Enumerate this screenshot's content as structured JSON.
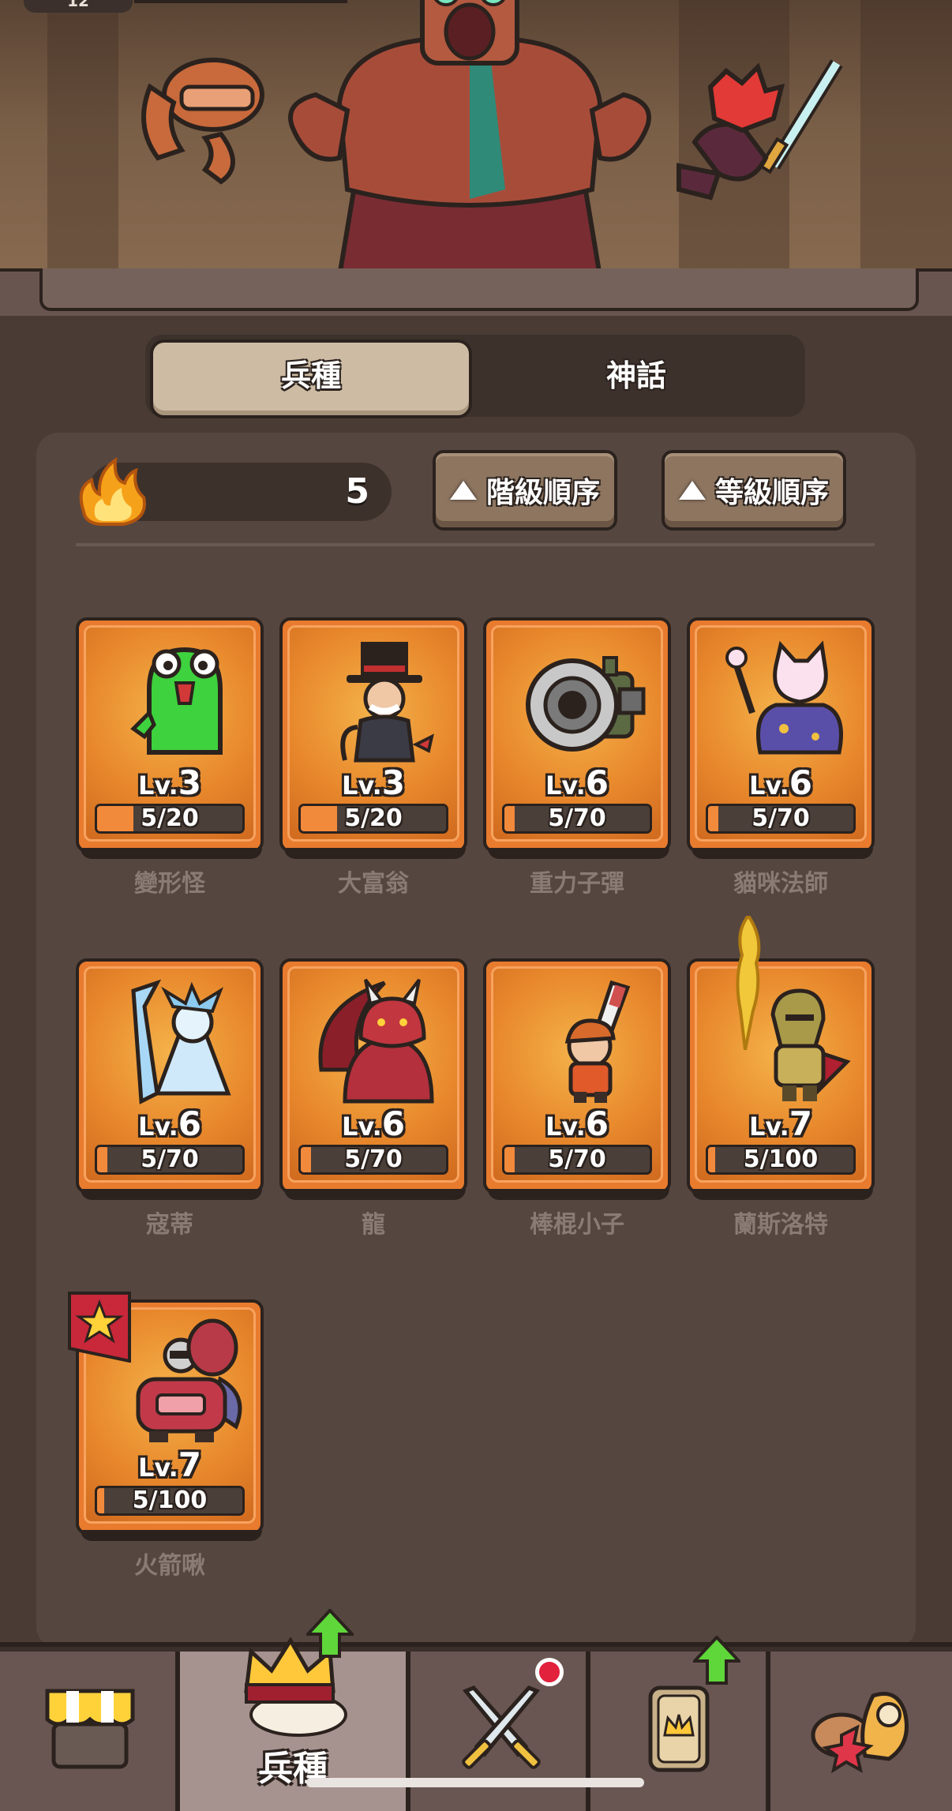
{
  "banner": {
    "level_pill": "12"
  },
  "tabs": [
    {
      "label": "兵種",
      "active": true
    },
    {
      "label": "神話",
      "active": false
    }
  ],
  "resource": {
    "icon": "fire-icon",
    "count": "5"
  },
  "sort_buttons": [
    {
      "label": "階級順序",
      "icon": "up-triangle-icon"
    },
    {
      "label": "等級順序",
      "icon": "up-triangle-icon"
    }
  ],
  "units": [
    {
      "name": "變形怪",
      "level_prefix": "Lv.",
      "level": "3",
      "progress_text": "5/20",
      "progress": 0.25
    },
    {
      "name": "大富翁",
      "level_prefix": "Lv.",
      "level": "3",
      "progress_text": "5/20",
      "progress": 0.25
    },
    {
      "name": "重力子彈",
      "level_prefix": "Lv.",
      "level": "6",
      "progress_text": "5/70",
      "progress": 0.07
    },
    {
      "name": "貓咪法師",
      "level_prefix": "Lv.",
      "level": "6",
      "progress_text": "5/70",
      "progress": 0.07
    },
    {
      "name": "寇蒂",
      "level_prefix": "Lv.",
      "level": "6",
      "progress_text": "5/70",
      "progress": 0.07
    },
    {
      "name": "龍",
      "level_prefix": "Lv.",
      "level": "6",
      "progress_text": "5/70",
      "progress": 0.07
    },
    {
      "name": "棒棍小子",
      "level_prefix": "Lv.",
      "level": "6",
      "progress_text": "5/70",
      "progress": 0.07
    },
    {
      "name": "蘭斯洛特",
      "level_prefix": "Lv.",
      "level": "7",
      "progress_text": "5/100",
      "progress": 0.05
    },
    {
      "name": "火箭啾",
      "level_prefix": "Lv.",
      "level": "7",
      "progress_text": "5/100",
      "progress": 0.05,
      "starred": true
    }
  ],
  "bottom_nav": [
    {
      "id": "shop",
      "icon": "shop-icon",
      "label": ""
    },
    {
      "id": "units",
      "icon": "crown-icon",
      "label": "兵種",
      "active": true,
      "upgrade_arrow": true
    },
    {
      "id": "battle",
      "icon": "crossed-swords-icon",
      "label": "",
      "notification": true
    },
    {
      "id": "cards",
      "icon": "card-icon",
      "label": "",
      "upgrade_arrow": true
    },
    {
      "id": "guild",
      "icon": "guild-icon",
      "label": ""
    }
  ],
  "colors": {
    "card_orange": "#e87b2e",
    "background": "#4a3c35",
    "progress_fill": "#f28a3c",
    "upgrade_arrow": "#5fd63a",
    "notification": "#e2213d"
  }
}
